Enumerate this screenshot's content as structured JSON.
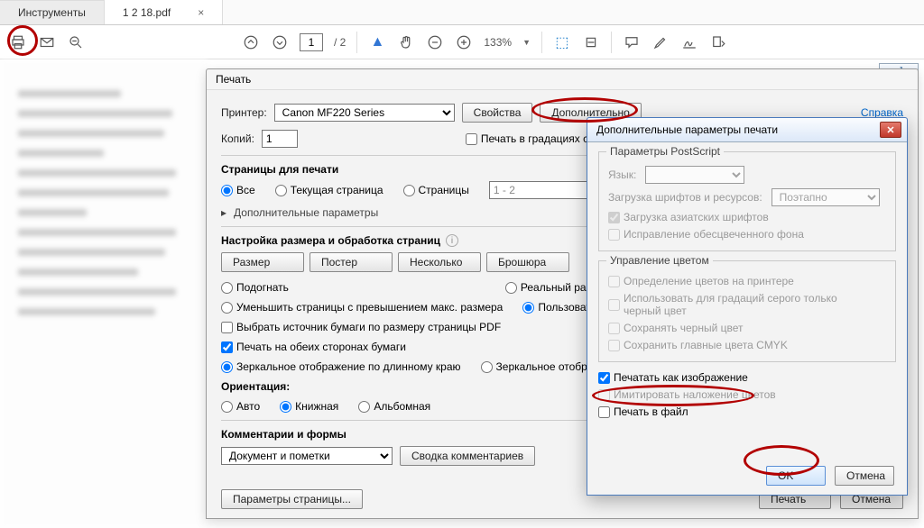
{
  "tabs": {
    "tools": "Инструменты",
    "file": "1 2 18.pdf"
  },
  "toolbar": {
    "page": "1",
    "pages": "2",
    "zoom": "133%"
  },
  "print": {
    "title": "Печать",
    "printer_lbl": "Принтер:",
    "printer_val": "Canon MF220 Series",
    "props": "Свойства",
    "advanced": "Дополнительно",
    "help": "Справка",
    "copies_lbl": "Копий:",
    "copies_val": "1",
    "grayscale": "Печать в градациях серого",
    "pages_h": "Страницы для печати",
    "all": "Все",
    "current": "Текущая страница",
    "range": "Страницы",
    "range_val": "1 - 2",
    "more": "Дополнительные параметры",
    "sizing_h": "Настройка размера и обработка страниц",
    "size_tab": "Размер",
    "poster_tab": "Постер",
    "multi_tab": "Несколько",
    "booklet_tab": "Брошюра",
    "fit": "Подогнать",
    "actual": "Реальный размер",
    "shrink": "Уменьшить страницы с превышением макс. размера",
    "custom": "Пользовательский масштаб",
    "source": "Выбрать источник бумаги по размеру страницы PDF",
    "duplex": "Печать на обеих сторонах бумаги",
    "flip_long": "Зеркальное отображение по длинному краю",
    "flip_short": "Зеркальное отображение по короткому",
    "orient_h": "Ориентация:",
    "auto": "Авто",
    "portrait": "Книжная",
    "landscape": "Альбомная",
    "comments_h": "Комментарии и формы",
    "comments_val": "Документ и пометки",
    "summary": "Сводка комментариев",
    "page_setup": "Параметры страницы...",
    "ok": "Печать",
    "cancel": "Отмена"
  },
  "adv": {
    "title": "Дополнительные параметры печати",
    "ps_h": "Параметры PostScript",
    "lang": "Язык:",
    "fonts": "Загрузка шрифтов и ресурсов:",
    "fonts_val": "Поэтапно",
    "asian": "Загрузка азиатских шрифтов",
    "bg": "Исправление обесцвеченного фона",
    "color_h": "Управление цветом",
    "c1": "Определение цветов на принтере",
    "c2": "Использовать для градаций серого только черный цвет",
    "c3": "Сохранять черный цвет",
    "c4": "Сохранить главные цвета CMYK",
    "as_image": "Печатать как изображение",
    "overprint": "Имитировать наложение цветов",
    "tofile": "Печать в файл",
    "ok": "OK",
    "cancel": "Отмена"
  }
}
